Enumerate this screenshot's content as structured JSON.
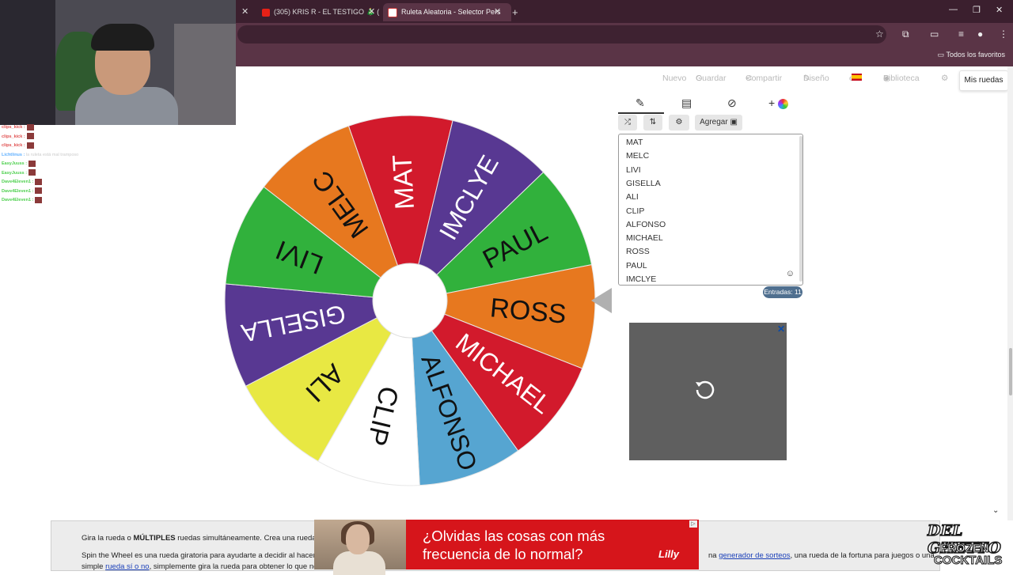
{
  "browser": {
    "tabs": [
      {
        "title": "(305) KRIS R - EL TESTIGO 🎄 (",
        "active": false
      },
      {
        "title": "Ruleta Aleatoria - Selector Pers",
        "active": true
      }
    ],
    "new_tab": "+",
    "bookmarks_all": "Todos los favoritos"
  },
  "stream": {
    "chat": [
      {
        "user": "clips_kick :",
        "color": "#e05050"
      },
      {
        "user": "clips_kick :",
        "color": "#e05050"
      },
      {
        "user": "clips_kick :",
        "color": "#e05050"
      },
      {
        "user": "Lichtlinus :",
        "msg": "la ruleta está mal tramposo",
        "color": "#5fb0ff"
      },
      {
        "user": "EasyJuuss :",
        "color": "#4fd04f"
      },
      {
        "user": "EasyJuuss :",
        "color": "#4fd04f"
      },
      {
        "user": "Dave4Eleven1 :",
        "color": "#4fd04f"
      },
      {
        "user": "Dave4Eleven1 :",
        "color": "#4fd04f"
      },
      {
        "user": "Dave4Eleven1 :",
        "color": "#4fd04f"
      }
    ],
    "logo_line1": "DEL GHETTO",
    "logo_line2": "FROZEN",
    "logo_line3": "COCKTAILS"
  },
  "nav": {
    "nuevo": "Nuevo",
    "guardar": "Guardar",
    "compartir": "Compartir",
    "diseno": "Diseño",
    "lang": "es",
    "biblioteca": "Biblioteca",
    "mis_ruedas": "Mis ruedas"
  },
  "panel": {
    "add_label": "Agregar",
    "entries_count": "Entradas: 11",
    "entries": [
      "MAT",
      "MELC",
      "LIVI",
      "GISELLA",
      "ALI",
      "CLIP",
      "ALFONSO",
      "MICHAEL",
      "ROSS",
      "PAUL",
      "IMCLYE"
    ]
  },
  "wheel": {
    "segments": [
      {
        "label": "MAT",
        "color": "#d21a2c"
      },
      {
        "label": "IMCLYE",
        "color": "#583892"
      },
      {
        "label": "PAUL",
        "color": "#31b13c"
      },
      {
        "label": "ROSS",
        "color": "#e7781f"
      },
      {
        "label": "MICHAEL",
        "color": "#d21a2c"
      },
      {
        "label": "ALFONSO",
        "color": "#56a5d1"
      },
      {
        "label": "CLIP",
        "color": "#ffffff"
      },
      {
        "label": "ALI",
        "color": "#e8e843"
      },
      {
        "label": "GISELLA",
        "color": "#583892"
      },
      {
        "label": "LIVI",
        "color": "#31b13c"
      },
      {
        "label": "MELC",
        "color": "#e7781f"
      }
    ]
  },
  "description": {
    "line1_pre": "Gira la rueda o ",
    "line1_bold": "MÚLTIPLES",
    "line1_post": " ruedas simultáneamente. Crea una rueda pe",
    "line2_pre": "Spin the Wheel es una rueda giratoria para ayudarte a decidir al hacer u",
    "line3_pre": "simple ",
    "line3_link": "rueda sí o no",
    "line3_post": ", simplemente gira la rueda para obtener lo que neces",
    "line2_right_pre": "na ",
    "line2_right_link": "generador de sorteos",
    "line2_right_post": ", una rueda de la fortuna para juegos o una"
  },
  "banner_ad": {
    "line1": "¿Olvidas las cosas con más",
    "line2": "frecuencia de lo normal?",
    "brand": "Lilly"
  }
}
